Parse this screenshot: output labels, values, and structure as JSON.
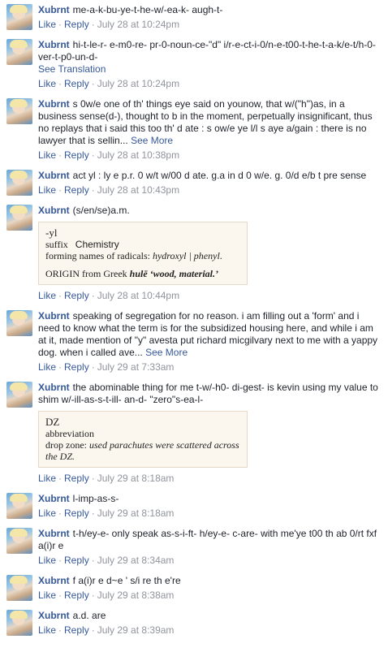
{
  "comments": [
    {
      "author": "Xubrnt",
      "text": "me-a-k-bu-ye-t-he-w/-ea-k- augh-t-",
      "like": "Like",
      "reply": "Reply",
      "time": "July 28 at 10:24pm"
    },
    {
      "author": "Xubrnt",
      "text": "hi-t-le-r- e-m0-re- pr-0-noun-ce-\"d\" i/r-e-ct-i-0/n-e-t00-t-he-t-a-k/e-t/h-0-ver-t-p0-un-d-",
      "see_translation": "See Translation",
      "like": "Like",
      "reply": "Reply",
      "time": "July 28 at 10:24pm"
    },
    {
      "author": "Xubrnt",
      "text": "s 0w/e one of th' things eye said on younow, that w/(\"h\")as, in a business sense(d-), thought to b in the moment, perpetually insignificant, thus no replays that i said this too th' d ate : s ow/e ye l/l s aye a/gain : there is no lawyer that is sellin...",
      "see_more": "See More",
      "like": "Like",
      "reply": "Reply",
      "time": "July 28 at 10:38pm"
    },
    {
      "author": "Xubrnt",
      "text": "act yl : ly e p.r. 0 w/t w/00 d ate. g.a in d 0 w/e. g. 0/d e/b t pre sense",
      "like": "Like",
      "reply": "Reply",
      "time": "July 28 at 10:43pm"
    },
    {
      "author": "Xubrnt",
      "text": "(s/en/se)a.m.",
      "dict": {
        "headword": "-yl",
        "pos": "suffix",
        "field": "Chemistry",
        "definition_prefix": "forming names of radicals:",
        "definition_examples": "hydroxyl | phenyl",
        "definition_end": ".",
        "origin_label": "ORIGIN",
        "origin_text": "from Greek",
        "origin_word": "hulē",
        "origin_meaning": "‘wood, material.’"
      },
      "like": "Like",
      "reply": "Reply",
      "time": "July 28 at 10:44pm"
    },
    {
      "author": "Xubrnt",
      "text": "speaking of segregation for no reason. i am filling out a 'form' and i need to know what the term is for the subsidized housing here, and while i am at it, made mention of \"y\" avesta put richard micgilvary next to me with a yappy dog. when i called ave...",
      "see_more": "See More",
      "like": "Like",
      "reply": "Reply",
      "time": "July 29 at 7:33am"
    },
    {
      "author": "Xubrnt",
      "text": "the abominable thing for me t-w/-h0- di-gest- is kevin using my value to shim w/-ill-as-s-t-ill- an-d- \"zero\"s-ea-l-",
      "dict": {
        "headword": "DZ",
        "pos": "abbreviation",
        "definition_prefix": "drop zone:",
        "definition_examples": "used parachutes were scattered across the DZ."
      },
      "like": "Like",
      "reply": "Reply",
      "time": "July 29 at 8:18am"
    },
    {
      "author": "Xubrnt",
      "text": "l-imp-as-s-",
      "like": "Like",
      "reply": "Reply",
      "time": "July 29 at 8:18am"
    },
    {
      "author": "Xubrnt",
      "text": "t-h/ey-e- only speak as-s-i-ft- h/ey-e- c-are- with me'ye t00 th ab 0/rt fxf a(i)r e",
      "like": "Like",
      "reply": "Reply",
      "time": "July 29 at 8:34am"
    },
    {
      "author": "Xubrnt",
      "text": "f a(i)r e d~e ' s/i re th e're",
      "like": "Like",
      "reply": "Reply",
      "time": "July 29 at 8:38am"
    },
    {
      "author": "Xubrnt",
      "text": "a.d. are",
      "like": "Like",
      "reply": "Reply",
      "time": "July 29 at 8:39am"
    }
  ],
  "colors": {
    "link": "#365899",
    "meta": "#90949c",
    "text": "#1d2129",
    "dict_bg": "#fbf6ee",
    "dict_border": "#e5d9c6"
  }
}
